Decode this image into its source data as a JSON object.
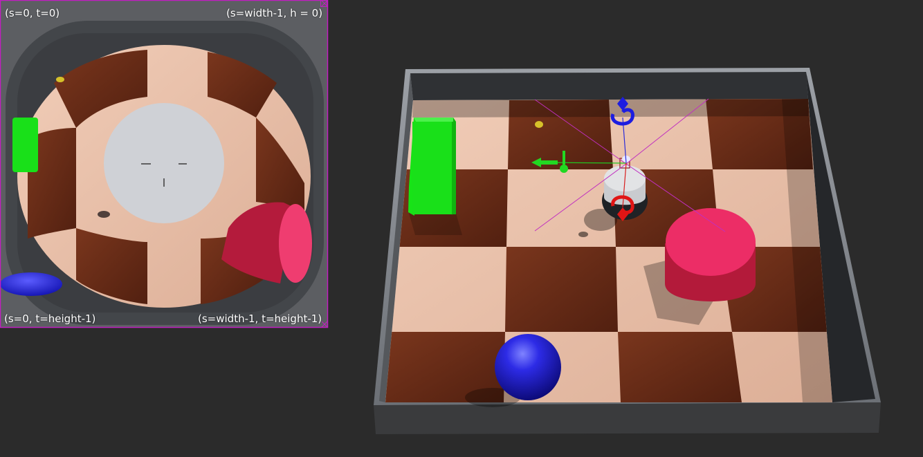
{
  "camera_view": {
    "corner_labels": {
      "top_left": "(s=0, t=0)",
      "top_right": "(s=width-1, h = 0)",
      "bottom_left": "(s=0, t=height-1)",
      "bottom_right": "(s=width-1, t=height-1)"
    }
  },
  "colors": {
    "background": "#2b2b2b",
    "selection_border": "#c21ec2",
    "green_box": "#19e119",
    "red_cylinder": "#e8205a",
    "blue_sphere": "#1f1fd9",
    "light_tile": "#e8c0a8",
    "dark_tile": "#6a2c18",
    "wall": "#4f5258"
  }
}
